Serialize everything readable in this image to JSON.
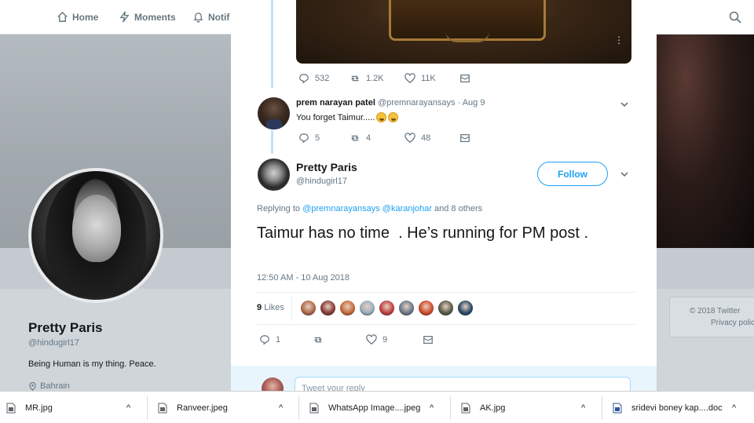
{
  "nav": {
    "home": "Home",
    "moments": "Moments",
    "notifications": "Notif"
  },
  "profile": {
    "name": "Pretty Paris",
    "handle": "@hindugirl17",
    "bio": "Being Human is my thing. Peace.",
    "location": "Bahrain"
  },
  "footer": {
    "line1": "© 2018 Twitter",
    "line2": "Privacy polic"
  },
  "parent_tweet": {
    "replies": "532",
    "retweets": "1.2K",
    "likes": "11K"
  },
  "reply_tweet": {
    "name": "prem narayan patel",
    "handle_date": "@premnarayansays · Aug 9",
    "text": "You forget Taimur.....",
    "replies": "5",
    "retweets": "4",
    "likes": "48"
  },
  "main_tweet": {
    "name": "Pretty Paris",
    "handle": "@hindugirl17",
    "follow_label": "Follow",
    "replying_prefix": "Replying to",
    "replying_to_1": "@premnarayansays",
    "replying_to_2": "@karanjohar",
    "replying_suffix": "and 8 others",
    "text": "Taimur has no time  . He’s running for PM post .",
    "timestamp": "12:50 AM - 10 Aug 2018",
    "likes_count": "9",
    "likes_label": "Likes",
    "replies": "1",
    "retweets": "",
    "likes": "9"
  },
  "reply_box": {
    "placeholder": "Tweet your reply"
  },
  "downloads": [
    {
      "name": "MR.jpg"
    },
    {
      "name": "Ranveer.jpeg"
    },
    {
      "name": "WhatsApp Image....jpeg"
    },
    {
      "name": "AK.jpg"
    },
    {
      "name": "sridevi boney kap....doc"
    }
  ],
  "liker_colors": [
    "#b06a4a",
    "#8a3a3a",
    "#c86a3a",
    "#9ab0c0",
    "#c04040",
    "#6a7a8a",
    "#d04a2a",
    "#5a5a4a",
    "#2a4a6a"
  ],
  "colors": {
    "accent": "#1da1f2",
    "text": "#14171a",
    "muted": "#657786"
  }
}
